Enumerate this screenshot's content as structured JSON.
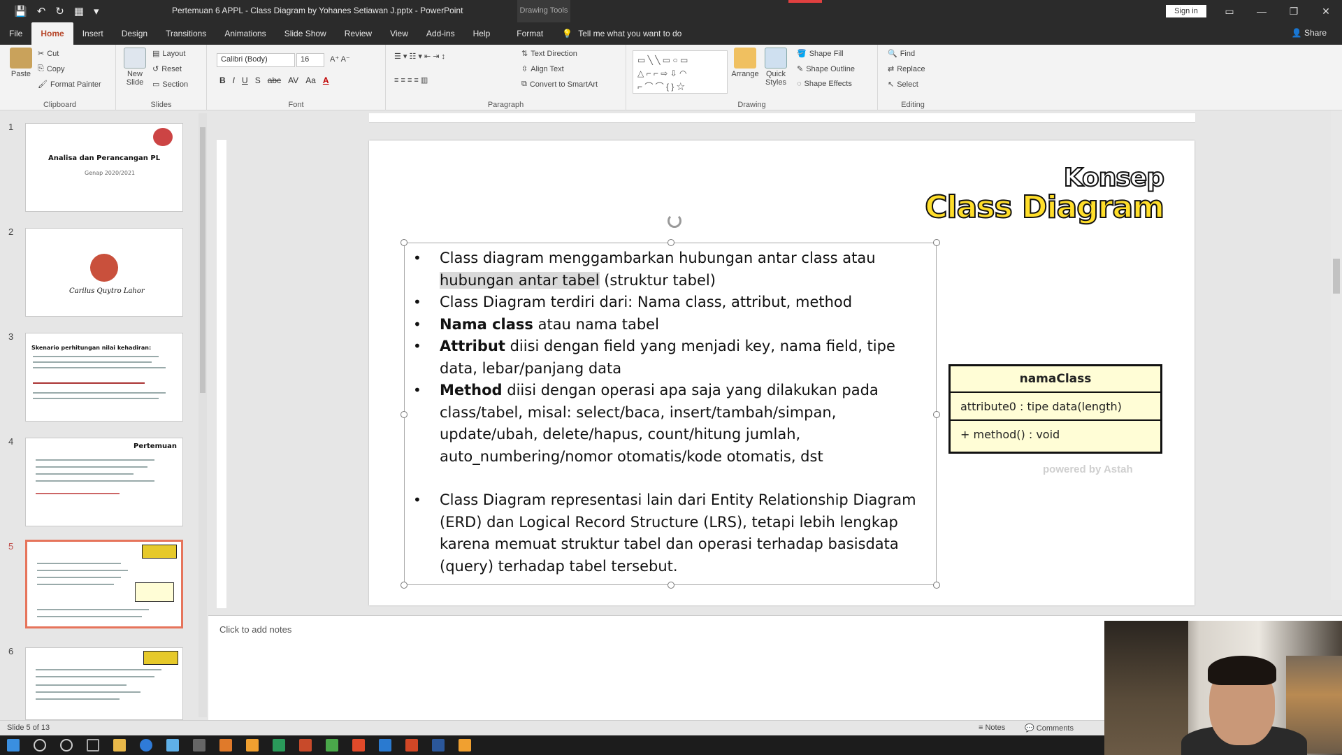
{
  "window": {
    "title": "Pertemuan 6 APPL - Class Diagram by Yohanes Setiawan J.pptx - PowerPoint",
    "contextual_tab_group": "Drawing Tools",
    "sign_in": "Sign in",
    "share": "Share"
  },
  "ribbon_tabs": [
    "File",
    "Home",
    "Insert",
    "Design",
    "Transitions",
    "Animations",
    "Slide Show",
    "Review",
    "View",
    "Add-ins",
    "Help"
  ],
  "format_tab": "Format",
  "tell_me": "Tell me what you want to do",
  "ribbon": {
    "clipboard": {
      "label": "Clipboard",
      "paste": "Paste",
      "cut": "Cut",
      "copy": "Copy",
      "format_painter": "Format Painter"
    },
    "slides": {
      "label": "Slides",
      "new_slide": "New Slide",
      "layout": "Layout",
      "reset": "Reset",
      "section": "Section"
    },
    "font": {
      "label": "Font",
      "family": "Calibri (Body)",
      "size": "16"
    },
    "paragraph": {
      "label": "Paragraph",
      "text_direction": "Text Direction",
      "align_text": "Align Text",
      "convert_smartart": "Convert to SmartArt"
    },
    "drawing": {
      "label": "Drawing",
      "arrange": "Arrange",
      "quick_styles": "Quick Styles",
      "shape_fill": "Shape Fill",
      "shape_outline": "Shape Outline",
      "shape_effects": "Shape Effects"
    },
    "editing": {
      "label": "Editing",
      "find": "Find",
      "replace": "Replace",
      "select": "Select"
    }
  },
  "thumbnails": [
    {
      "num": "1",
      "title": "Analisa dan Perancangan PL",
      "subtitle": "Genap 2020/2021"
    },
    {
      "num": "2",
      "title": "Carilus Quytro Lahor"
    },
    {
      "num": "3",
      "title": "Skenario perhitungan nilai kehadiran:"
    },
    {
      "num": "4",
      "title": "Pertemuan"
    },
    {
      "num": "5",
      "title": "Konsep Class Diagram"
    },
    {
      "num": "6",
      "title": "Konsep Class Diagram"
    }
  ],
  "slide": {
    "title_line1": "Konsep",
    "title_line2": "Class Diagram",
    "bullet1_a": "Class diagram menggambarkan hubungan antar class atau",
    "bullet1_hl": "hubungan antar tabel",
    "bullet1_b": " (struktur tabel)",
    "bullet2": "Class Diagram terdiri dari: Nama class, attribut, method",
    "bullet3_bold": "Nama class",
    "bullet3_rest": " atau nama tabel",
    "bullet4_bold": "Attribut",
    "bullet4_rest": " diisi dengan field yang menjadi key, nama field, tipe data, lebar/panjang data",
    "bullet5_bold": "Method",
    "bullet5_rest": " diisi dengan operasi apa saja yang dilakukan pada class/tabel, misal: select/baca, insert/tambah/simpan, update/ubah, delete/hapus, count/hitung jumlah, auto_numbering/nomor otomatis/kode otomatis, dst",
    "bullet6": "Class Diagram representasi lain dari Entity Relationship Diagram (ERD) dan Logical Record Structure (LRS), tetapi lebih lengkap karena memuat struktur tabel dan operasi terhadap basisdata (query) terhadap tabel tersebut.",
    "uml": {
      "class_name": "namaClass",
      "attribute": "attribute0 : tipe data(length)",
      "method": "+ method() : void"
    },
    "powered_prefix": "powered by Astah",
    "powered_suffix": ""
  },
  "notes_placeholder": "Click to add notes",
  "status": {
    "slide_info": "Slide 5 of 13",
    "notes": "Notes",
    "comments": "Comments"
  }
}
